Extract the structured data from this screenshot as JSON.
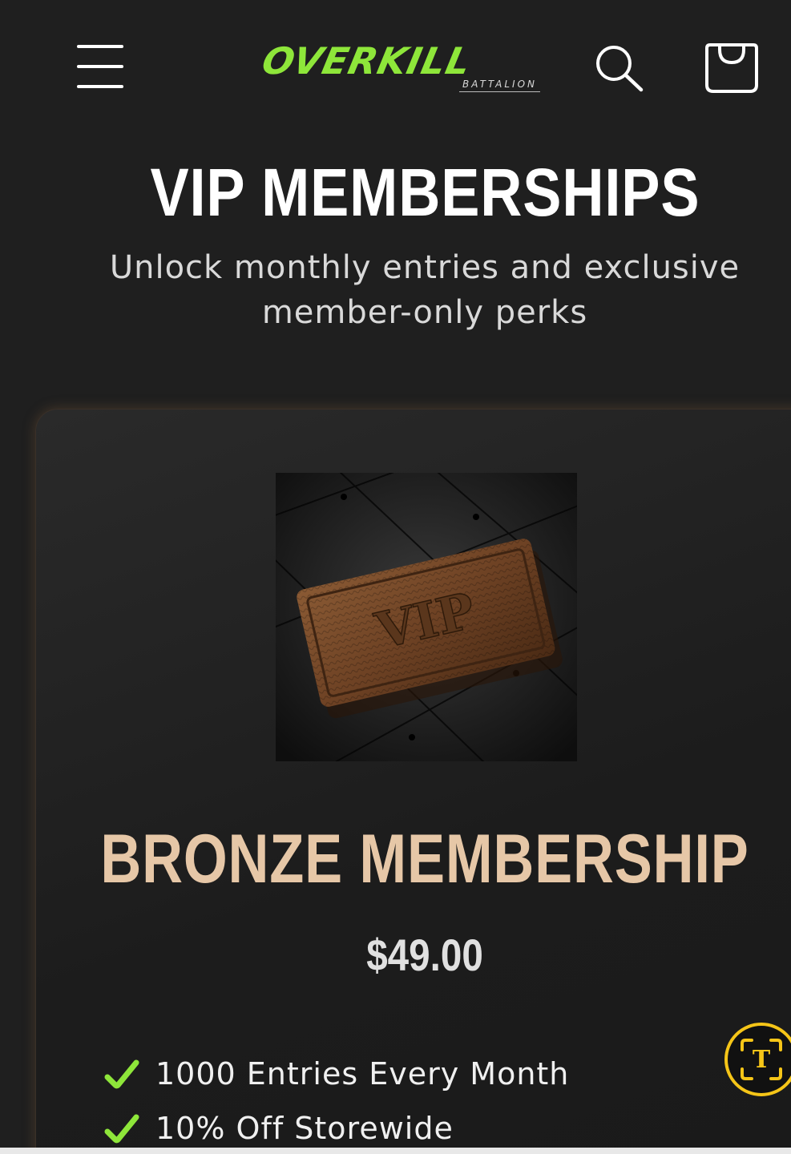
{
  "header": {
    "logo_main": "OVERKILL",
    "logo_sub": "BATTALION",
    "icons": {
      "menu": "hamburger-menu-icon",
      "search": "search-icon",
      "cart": "shopping-bag-icon"
    },
    "colors": {
      "logo": "#8ee63a",
      "icon": "#ffffff"
    }
  },
  "hero": {
    "title": "VIP MEMBERSHIPS",
    "subtitle": "Unlock monthly entries and exclusive member-only perks"
  },
  "membership": {
    "image_label": "VIP",
    "title": "BRONZE MEMBERSHIP",
    "price": "$49.00",
    "features": [
      "1000 Entries Every Month",
      "10% Off Storewide"
    ],
    "colors": {
      "title": "#e6c7a7",
      "check": "#8ee63a",
      "card_glow": "#78553a"
    }
  },
  "floating": {
    "translate_icon": "text-recognition-icon",
    "translate_glyph": "T",
    "accent": "#f5c518"
  }
}
